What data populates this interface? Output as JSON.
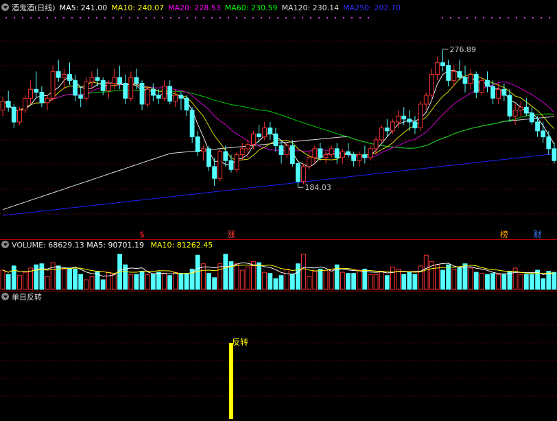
{
  "chart_data": {
    "type": "candlestick",
    "title": "酒鬼酒(日线)",
    "price_panel": {
      "indicators": [
        {
          "key": "MA5",
          "label": "MA5:",
          "value": "241.00",
          "color": "#ffffff"
        },
        {
          "key": "MA10",
          "label": "MA10:",
          "value": "240.07",
          "color": "#ffff00"
        },
        {
          "key": "MA20",
          "label": "MA20:",
          "value": "228.53",
          "color": "#ff00ff"
        },
        {
          "key": "MA60",
          "label": "MA60:",
          "value": "230.59",
          "color": "#00ff00"
        },
        {
          "key": "MA120",
          "label": "MA120:",
          "value": "230.14",
          "color": "#dddddd"
        },
        {
          "key": "MA250",
          "label": "MA250:",
          "value": "202.70",
          "color": "#3030ff"
        }
      ],
      "high_label": "276.89",
      "low_label": "184.03",
      "markers": [
        {
          "text": "$",
          "index": 25,
          "color": "#ff2020"
        },
        {
          "text": "涨",
          "index": 41,
          "color": "#ff4040"
        },
        {
          "text": "榜",
          "index": 90,
          "color": "#ffa500"
        },
        {
          "text": "财",
          "index": 96,
          "color": "#4080ff"
        }
      ],
      "ylim": [
        155,
        300
      ],
      "candles": [
        [
          236,
          245,
          232,
          242
        ],
        [
          242,
          249,
          235,
          238
        ],
        [
          238,
          240,
          224,
          228
        ],
        [
          228,
          238,
          226,
          236
        ],
        [
          236,
          246,
          234,
          244
        ],
        [
          244,
          256,
          240,
          250
        ],
        [
          250,
          262,
          244,
          248
        ],
        [
          248,
          252,
          238,
          241
        ],
        [
          241,
          246,
          236,
          244
        ],
        [
          244,
          266,
          242,
          262
        ],
        [
          262,
          270,
          255,
          258
        ],
        [
          258,
          264,
          250,
          260
        ],
        [
          260,
          268,
          253,
          256
        ],
        [
          256,
          260,
          242,
          246
        ],
        [
          246,
          252,
          238,
          244
        ],
        [
          244,
          258,
          242,
          255
        ],
        [
          255,
          262,
          250,
          258
        ],
        [
          258,
          264,
          252,
          256
        ],
        [
          256,
          258,
          246,
          249
        ],
        [
          249,
          256,
          244,
          254
        ],
        [
          254,
          264,
          250,
          258
        ],
        [
          258,
          266,
          250,
          254
        ],
        [
          254,
          260,
          240,
          244
        ],
        [
          244,
          262,
          242,
          258
        ],
        [
          258,
          264,
          250,
          254
        ],
        [
          254,
          256,
          236,
          240
        ],
        [
          240,
          252,
          238,
          250
        ],
        [
          250,
          254,
          242,
          246
        ],
        [
          246,
          250,
          240,
          244
        ],
        [
          244,
          256,
          242,
          252
        ],
        [
          252,
          256,
          240,
          242
        ],
        [
          242,
          250,
          238,
          246
        ],
        [
          246,
          248,
          236,
          244
        ],
        [
          244,
          246,
          232,
          236
        ],
        [
          236,
          238,
          214,
          218
        ],
        [
          218,
          222,
          205,
          208
        ],
        [
          208,
          212,
          202,
          210
        ],
        [
          210,
          212,
          195,
          198
        ],
        [
          198,
          204,
          185,
          190
        ],
        [
          190,
          210,
          188,
          208
        ],
        [
          208,
          212,
          198,
          202
        ],
        [
          202,
          206,
          194,
          196
        ],
        [
          196,
          208,
          194,
          206
        ],
        [
          206,
          214,
          202,
          210
        ],
        [
          210,
          216,
          204,
          213
        ],
        [
          213,
          222,
          210,
          220
        ],
        [
          220,
          226,
          214,
          218
        ],
        [
          218,
          228,
          216,
          224
        ],
        [
          224,
          228,
          216,
          220
        ],
        [
          220,
          224,
          208,
          212
        ],
        [
          212,
          216,
          200,
          206
        ],
        [
          206,
          214,
          204,
          212
        ],
        [
          212,
          216,
          198,
          200
        ],
        [
          200,
          202,
          184,
          188
        ],
        [
          188,
          200,
          186,
          198
        ],
        [
          198,
          208,
          196,
          204
        ],
        [
          204,
          212,
          200,
          210
        ],
        [
          210,
          214,
          202,
          204
        ],
        [
          204,
          208,
          200,
          206
        ],
        [
          206,
          212,
          204,
          210
        ],
        [
          210,
          214,
          200,
          204
        ],
        [
          204,
          210,
          200,
          208
        ],
        [
          208,
          214,
          204,
          206
        ],
        [
          206,
          208,
          198,
          202
        ],
        [
          202,
          208,
          198,
          206
        ],
        [
          206,
          212,
          200,
          204
        ],
        [
          204,
          212,
          202,
          210
        ],
        [
          210,
          218,
          206,
          216
        ],
        [
          216,
          226,
          214,
          224
        ],
        [
          224,
          230,
          218,
          222
        ],
        [
          222,
          230,
          220,
          228
        ],
        [
          228,
          236,
          224,
          232
        ],
        [
          232,
          238,
          226,
          230
        ],
        [
          230,
          236,
          222,
          228
        ],
        [
          228,
          232,
          220,
          224
        ],
        [
          224,
          242,
          222,
          240
        ],
        [
          240,
          248,
          236,
          246
        ],
        [
          246,
          264,
          244,
          260
        ],
        [
          260,
          272,
          256,
          268
        ],
        [
          268,
          277,
          262,
          266
        ],
        [
          266,
          270,
          252,
          256
        ],
        [
          256,
          266,
          252,
          262
        ],
        [
          262,
          270,
          256,
          258
        ],
        [
          258,
          266,
          248,
          254
        ],
        [
          254,
          264,
          250,
          260
        ],
        [
          260,
          262,
          244,
          248
        ],
        [
          248,
          258,
          246,
          256
        ],
        [
          256,
          262,
          248,
          252
        ],
        [
          252,
          256,
          240,
          244
        ],
        [
          244,
          254,
          240,
          250
        ],
        [
          250,
          254,
          242,
          246
        ],
        [
          246,
          250,
          228,
          232
        ],
        [
          232,
          240,
          226,
          236
        ],
        [
          236,
          242,
          232,
          238
        ],
        [
          238,
          244,
          232,
          234
        ],
        [
          234,
          238,
          226,
          228
        ],
        [
          228,
          232,
          218,
          222
        ],
        [
          222,
          228,
          214,
          218
        ],
        [
          218,
          222,
          206,
          210
        ],
        [
          210,
          214,
          200,
          202
        ]
      ]
    },
    "volume_panel": {
      "label": "VOLUME:",
      "value": "68629.13",
      "ma5_label": "MA5:",
      "ma5_value": "90701.19",
      "ma10_label": "MA10:",
      "ma10_value": "81262.45",
      "ma5_color": "#ffffff",
      "ma10_color": "#ffff00",
      "ylim": [
        0,
        180000
      ],
      "values": [
        90000,
        70000,
        110000,
        65000,
        80000,
        100000,
        115000,
        120000,
        60000,
        125000,
        110000,
        95000,
        100000,
        95000,
        70000,
        45000,
        60000,
        85000,
        45000,
        80000,
        70000,
        165000,
        115000,
        70000,
        70000,
        85000,
        70000,
        70000,
        80000,
        75000,
        65000,
        80000,
        75000,
        75000,
        95000,
        160000,
        120000,
        75000,
        55000,
        120000,
        165000,
        130000,
        120000,
        90000,
        105000,
        130000,
        125000,
        80000,
        75000,
        50000,
        65000,
        95000,
        70000,
        120000,
        165000,
        60000,
        85000,
        95000,
        90000,
        95000,
        115000,
        80000,
        75000,
        75000,
        90000,
        95000,
        70000,
        70000,
        85000,
        65000,
        105000,
        95000,
        70000,
        80000,
        70000,
        110000,
        160000,
        130000,
        115000,
        90000,
        115000,
        95000,
        100000,
        120000,
        100000,
        80000,
        75000,
        70000,
        75000,
        70000,
        70000,
        85000,
        100000,
        70000,
        70000,
        70000,
        90000,
        50000,
        85000,
        80000
      ]
    },
    "indicator_panel": {
      "title": "单日反转",
      "signal_label": "反转",
      "signal_index": 41,
      "signal_color": "#ffff00"
    }
  }
}
